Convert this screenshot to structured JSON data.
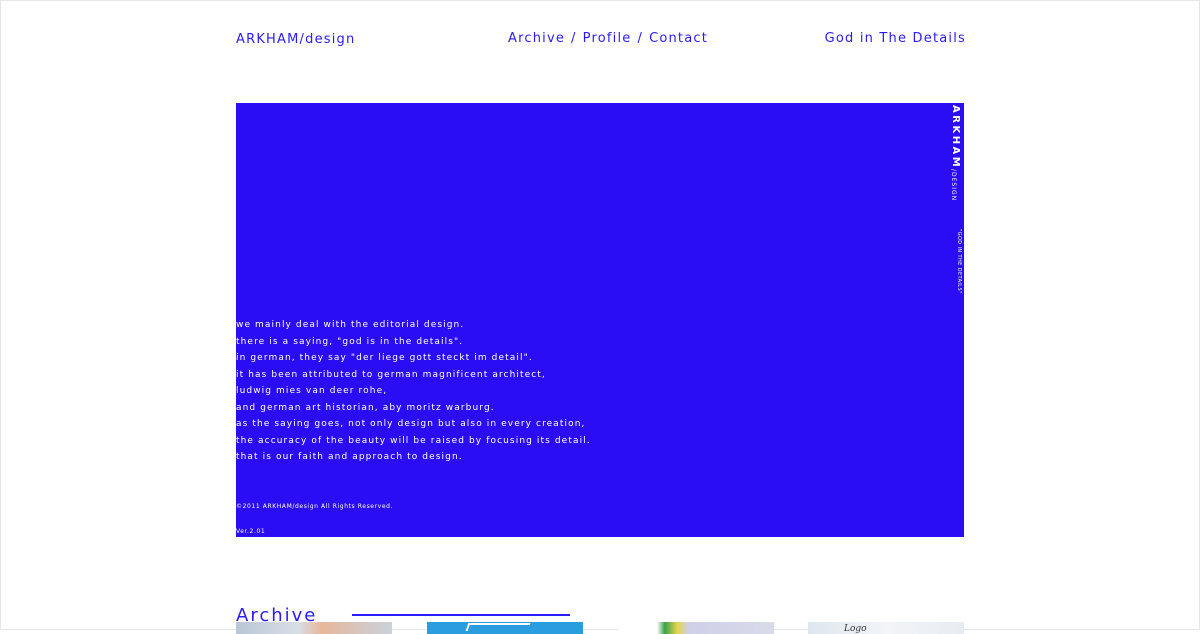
{
  "header": {
    "brand": "ARKHAM/design",
    "nav": [
      {
        "label": "Archive"
      },
      {
        "label": "Profile"
      },
      {
        "label": "Contact"
      }
    ],
    "separator": "/",
    "tagline": "God in The Details"
  },
  "hero": {
    "lines": [
      "we mainly deal with the editorial design.",
      "there is a saying, \"god is in the details\".",
      "in german, they say \"der liege gott steckt im detail\".",
      "it has been attributed to german magnificent architect,",
      "ludwig mies van deer rohe,",
      "and german art historian, aby moritz warburg.",
      "as the saying goes, not only design but also in every creation,",
      "the accuracy of the beauty will be raised by focusing its detail.",
      "that is our faith and approach to design."
    ],
    "copyright": "©2011 ARKHAM/design All Rights Reserved.",
    "version": "Ver.2.01",
    "side_brand": "ARKHAM",
    "side_sub": "/DESIGN",
    "side_tag": "\"GOD IN THE DETAILS\""
  },
  "archive": {
    "title": "Archive",
    "thumb_text": "Logo"
  },
  "colors": {
    "accent": "#2a1bff",
    "hero_bg": "#2a0df5",
    "text_on_hero": "#ffffff"
  }
}
